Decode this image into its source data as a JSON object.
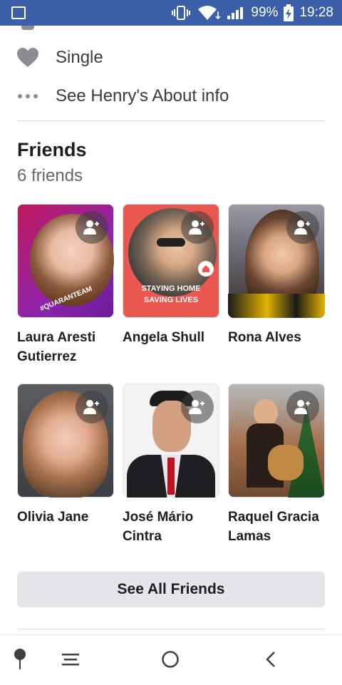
{
  "status_bar": {
    "battery": "99%",
    "time": "19:28"
  },
  "about": {
    "relationship": "Single",
    "see_about": "See Henry's About info"
  },
  "friends": {
    "title": "Friends",
    "count": "6 friends",
    "people": [
      {
        "name_line1": "Laura Aresti",
        "name_line2": "Gutierrez",
        "overlay_text": [
          "#QUARANTEAM"
        ]
      },
      {
        "name_line1": "Angela Shull",
        "name_line2": "",
        "overlay_text": [
          "STAYING HOME",
          "SAVING LIVES"
        ]
      },
      {
        "name_line1": "Rona Alves",
        "name_line2": ""
      },
      {
        "name_line1": "Olivia Jane",
        "name_line2": ""
      },
      {
        "name_line1": "José Mário",
        "name_line2": "Cintra"
      },
      {
        "name_line1": "Raquel Gracia",
        "name_line2": "Lamas"
      }
    ],
    "see_all_label": "See All Friends"
  },
  "colors": {
    "status_bar": "#3b5fa8",
    "button_bg": "#e4e6eb"
  },
  "icons": {
    "status": [
      "image-icon",
      "vibrate-icon",
      "wifi-icon",
      "signal-icon",
      "battery-charging-icon"
    ],
    "nav": [
      "pin-icon",
      "menu-icon",
      "home-circle-icon",
      "back-icon"
    ]
  }
}
